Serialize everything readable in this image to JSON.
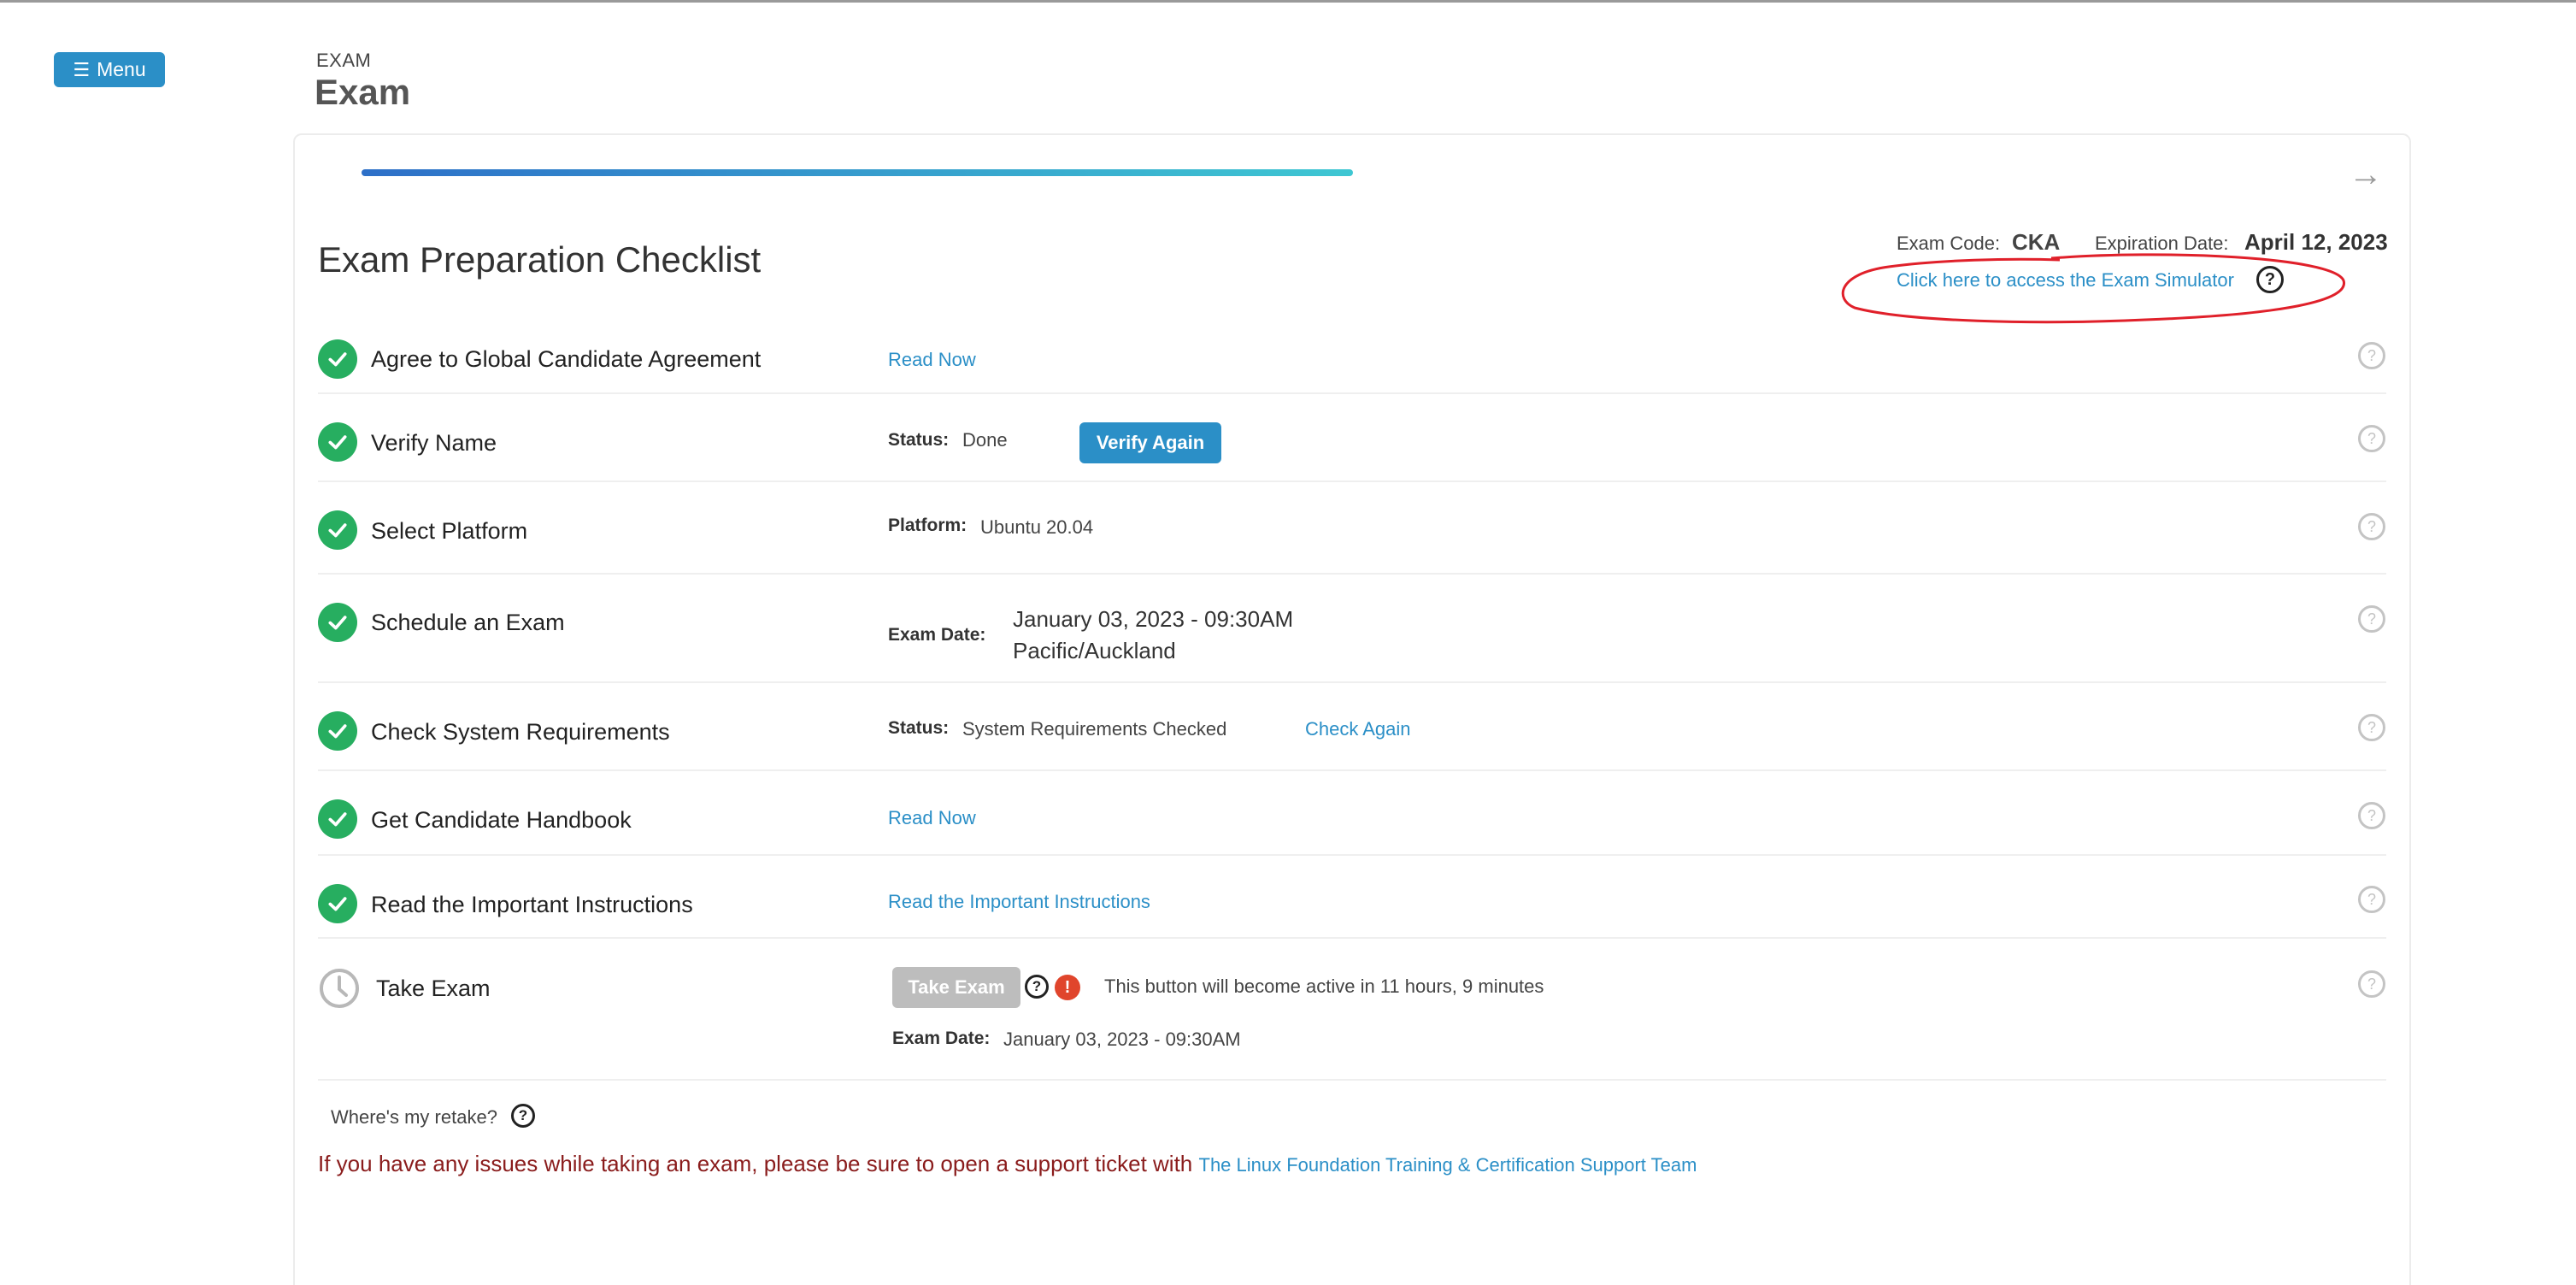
{
  "menu": {
    "label": "Menu"
  },
  "header": {
    "eyebrow": "EXAM",
    "title": "Exam"
  },
  "checklist": {
    "title": "Exam Preparation Checklist",
    "progress": 0.48,
    "exam_code_label": "Exam Code:",
    "exam_code": "CKA",
    "expiration_label": "Expiration Date:",
    "expiration_date": "April 12, 2023",
    "simulator_link": "Click here to access the Exam Simulator"
  },
  "rows": {
    "agree": {
      "label": "Agree to Global Candidate Agreement",
      "link": "Read Now"
    },
    "verify": {
      "label": "Verify Name",
      "status_label": "Status:",
      "status": "Done",
      "button": "Verify Again"
    },
    "platform": {
      "label": "Select Platform",
      "platform_label": "Platform:",
      "platform": "Ubuntu 20.04"
    },
    "schedule": {
      "label": "Schedule an Exam",
      "date_label": "Exam Date:",
      "date": "January 03, 2023 - 09:30AM",
      "timezone": "Pacific/Auckland"
    },
    "system": {
      "label": "Check System Requirements",
      "status_label": "Status:",
      "status": "System Requirements Checked",
      "link": "Check Again"
    },
    "handbook": {
      "label": "Get Candidate Handbook",
      "link": "Read Now"
    },
    "instructions": {
      "label": "Read the Important Instructions",
      "link": "Read the Important Instructions"
    },
    "take": {
      "label": "Take Exam",
      "button": "Take Exam",
      "message": "This button will become active in 11 hours, 9 minutes",
      "date_label": "Exam Date:",
      "date": "January 03, 2023 - 09:30AM"
    }
  },
  "retake": {
    "label": "Where's my retake?"
  },
  "support": {
    "text": "If you have any issues while taking an exam, please be sure to open a support ticket with",
    "link": "The Linux Foundation Training & Certification Support Team"
  },
  "icons": {
    "help": "?",
    "alert": "!",
    "arrow": "→",
    "hamburger": "☰"
  },
  "colors": {
    "accent": "#2b8fc7",
    "success": "#27ae60",
    "danger": "#e0452c",
    "annotation": "#e0202a"
  }
}
